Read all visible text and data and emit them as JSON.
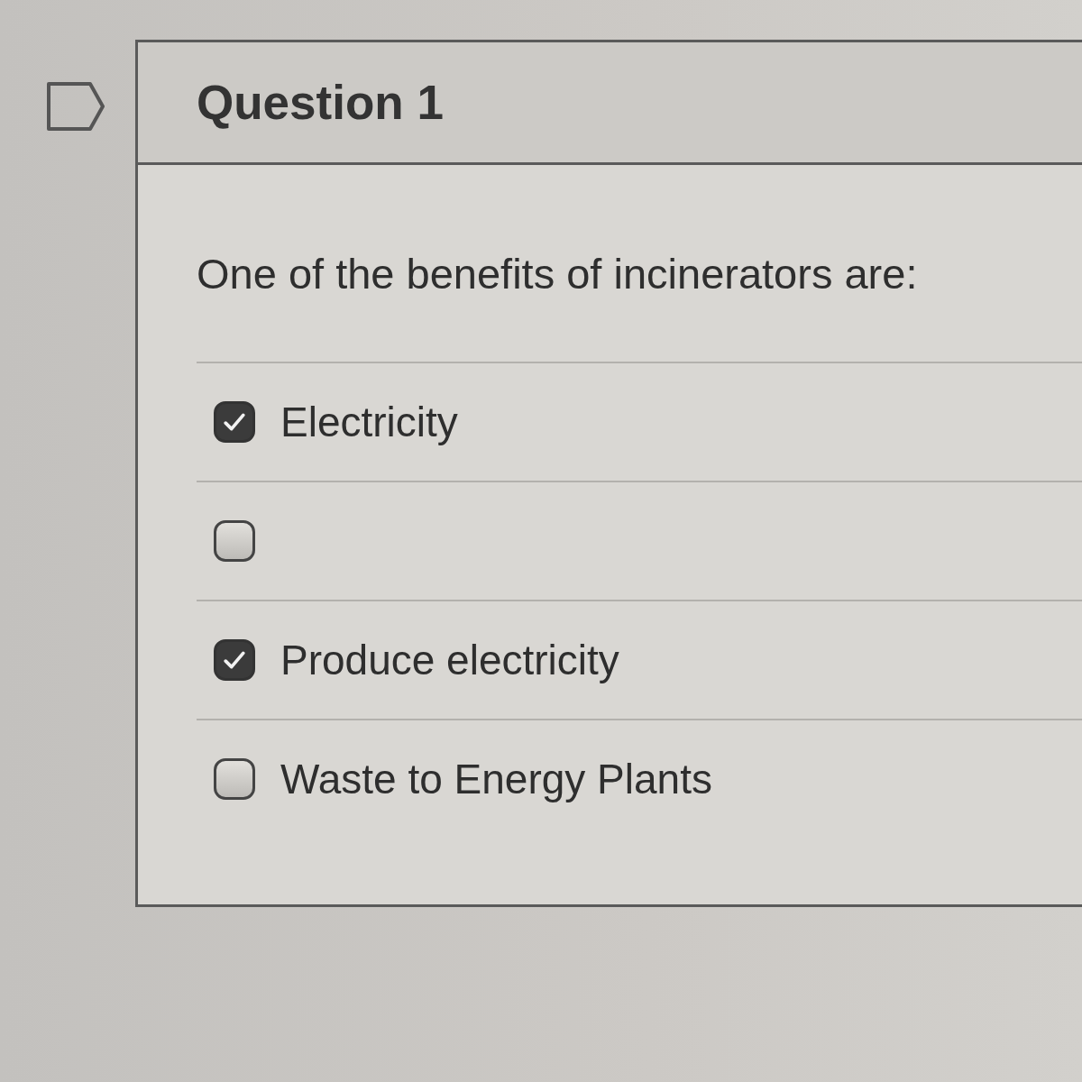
{
  "question": {
    "title": "Question 1",
    "text": "One of the benefits of incinerators are:",
    "options": [
      {
        "label": "Electricity",
        "checked": true
      },
      {
        "checked": false
      },
      {
        "label": "Produce electricity",
        "checked": true
      },
      {
        "label": "Waste to Energy Plants",
        "checked": false
      }
    ]
  }
}
